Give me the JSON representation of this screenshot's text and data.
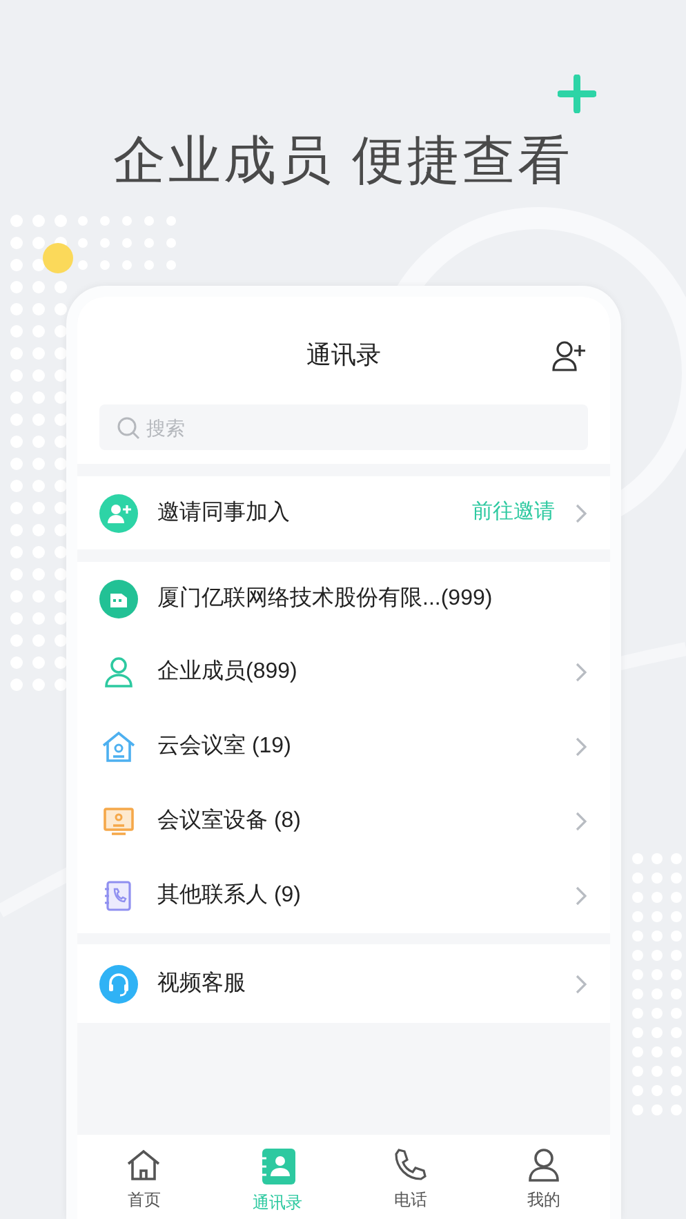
{
  "headline": "企业成员 便捷查看",
  "header": {
    "title": "通讯录"
  },
  "search": {
    "placeholder": "搜索"
  },
  "invite": {
    "label": "邀请同事加入",
    "action": "前往邀请"
  },
  "company": {
    "label": "厦门亿联网络技术股份有限...(999)"
  },
  "contacts": [
    {
      "kind": "member",
      "label": "企业成员(899)"
    },
    {
      "kind": "room",
      "label": "云会议室 (19)"
    },
    {
      "kind": "device",
      "label": "会议室设备 (8)"
    },
    {
      "kind": "other",
      "label": "其他联系人 (9)"
    }
  ],
  "service": {
    "label": "视频客服"
  },
  "tabs": [
    {
      "kind": "home",
      "label": "首页",
      "selected": false
    },
    {
      "kind": "contacts",
      "label": "通讯录",
      "selected": true
    },
    {
      "kind": "phone",
      "label": "电话",
      "selected": false
    },
    {
      "kind": "me",
      "label": "我的",
      "selected": false
    }
  ]
}
